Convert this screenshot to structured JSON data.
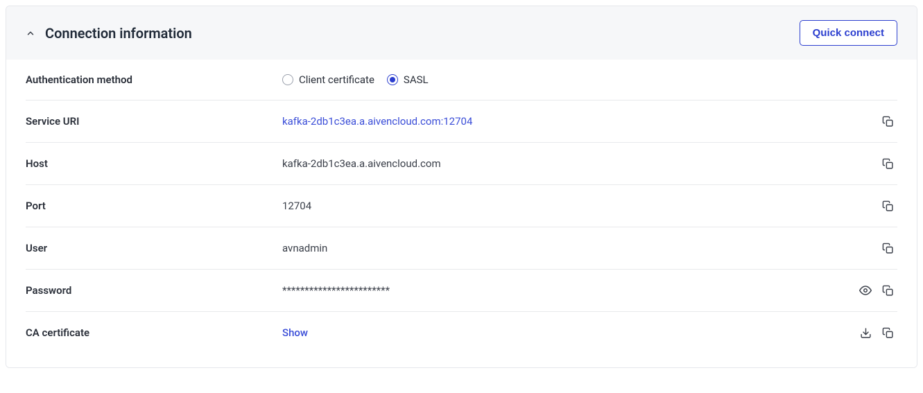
{
  "header": {
    "title": "Connection information",
    "quick_connect_label": "Quick connect"
  },
  "auth_method": {
    "label": "Authentication method",
    "options": {
      "client_cert": "Client certificate",
      "sasl": "SASL"
    },
    "selected": "sasl"
  },
  "rows": {
    "service_uri": {
      "label": "Service URI",
      "value": "kafka-2db1c3ea.a.aivencloud.com:12704"
    },
    "host": {
      "label": "Host",
      "value": "kafka-2db1c3ea.a.aivencloud.com"
    },
    "port": {
      "label": "Port",
      "value": "12704"
    },
    "user": {
      "label": "User",
      "value": "avnadmin"
    },
    "password": {
      "label": "Password",
      "value": "************************"
    },
    "ca_cert": {
      "label": "CA certificate",
      "show_label": "Show"
    }
  }
}
